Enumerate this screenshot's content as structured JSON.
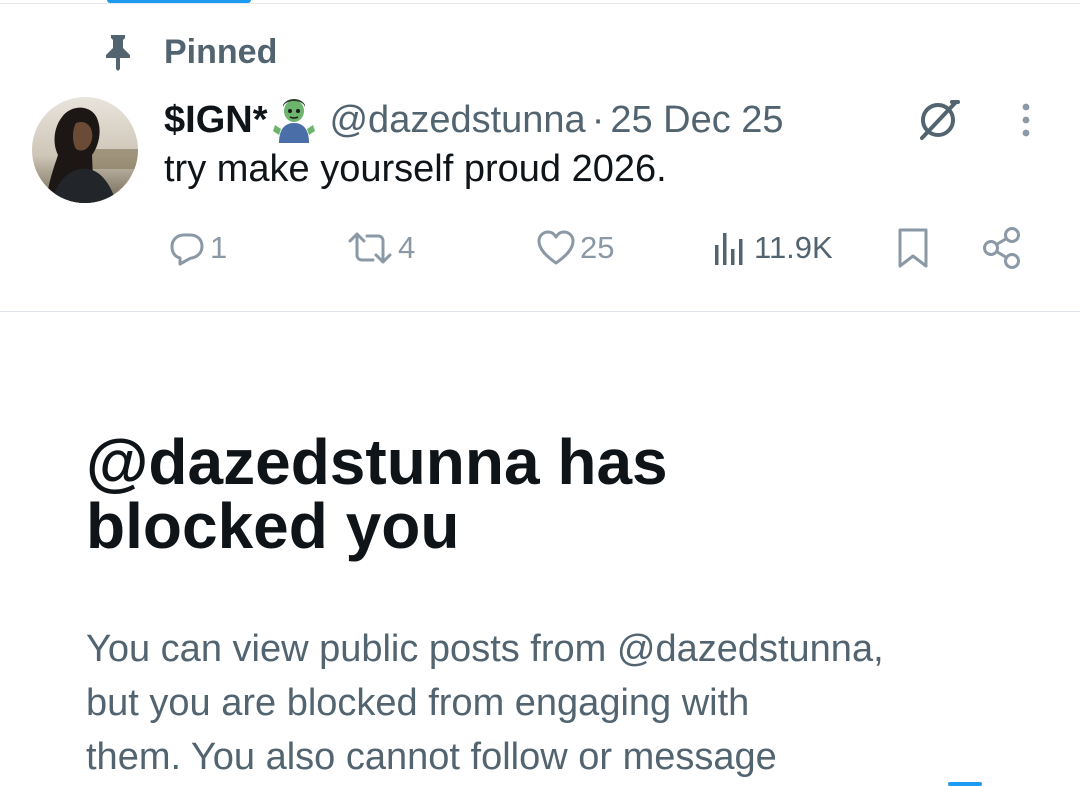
{
  "pinned": {
    "label": "Pinned",
    "icon": "pin-icon"
  },
  "post": {
    "avatar_icon": "avatar-photo",
    "display_name": "$IGN*",
    "emoji": "zombie-man-emoji",
    "handle": "@dazedstunna",
    "separator": "·",
    "date": "25 Dec 25",
    "text": "try make yourself proud 2026.",
    "actions": {
      "replies": "1",
      "reposts": "4",
      "likes": "25",
      "views": "11.9K"
    }
  },
  "blocked": {
    "title_line1": "@dazedstunna has",
    "title_line2": "blocked you",
    "desc_line1": "You can view public posts from @dazedstunna,",
    "desc_line2": "but you are blocked from engaging with",
    "desc_line3": "them. You also cannot follow or message"
  },
  "colors": {
    "primary_text": "#0f1419",
    "secondary_text": "#536471",
    "action_gray": "#8b98a5",
    "accent": "#1d9bf0"
  }
}
